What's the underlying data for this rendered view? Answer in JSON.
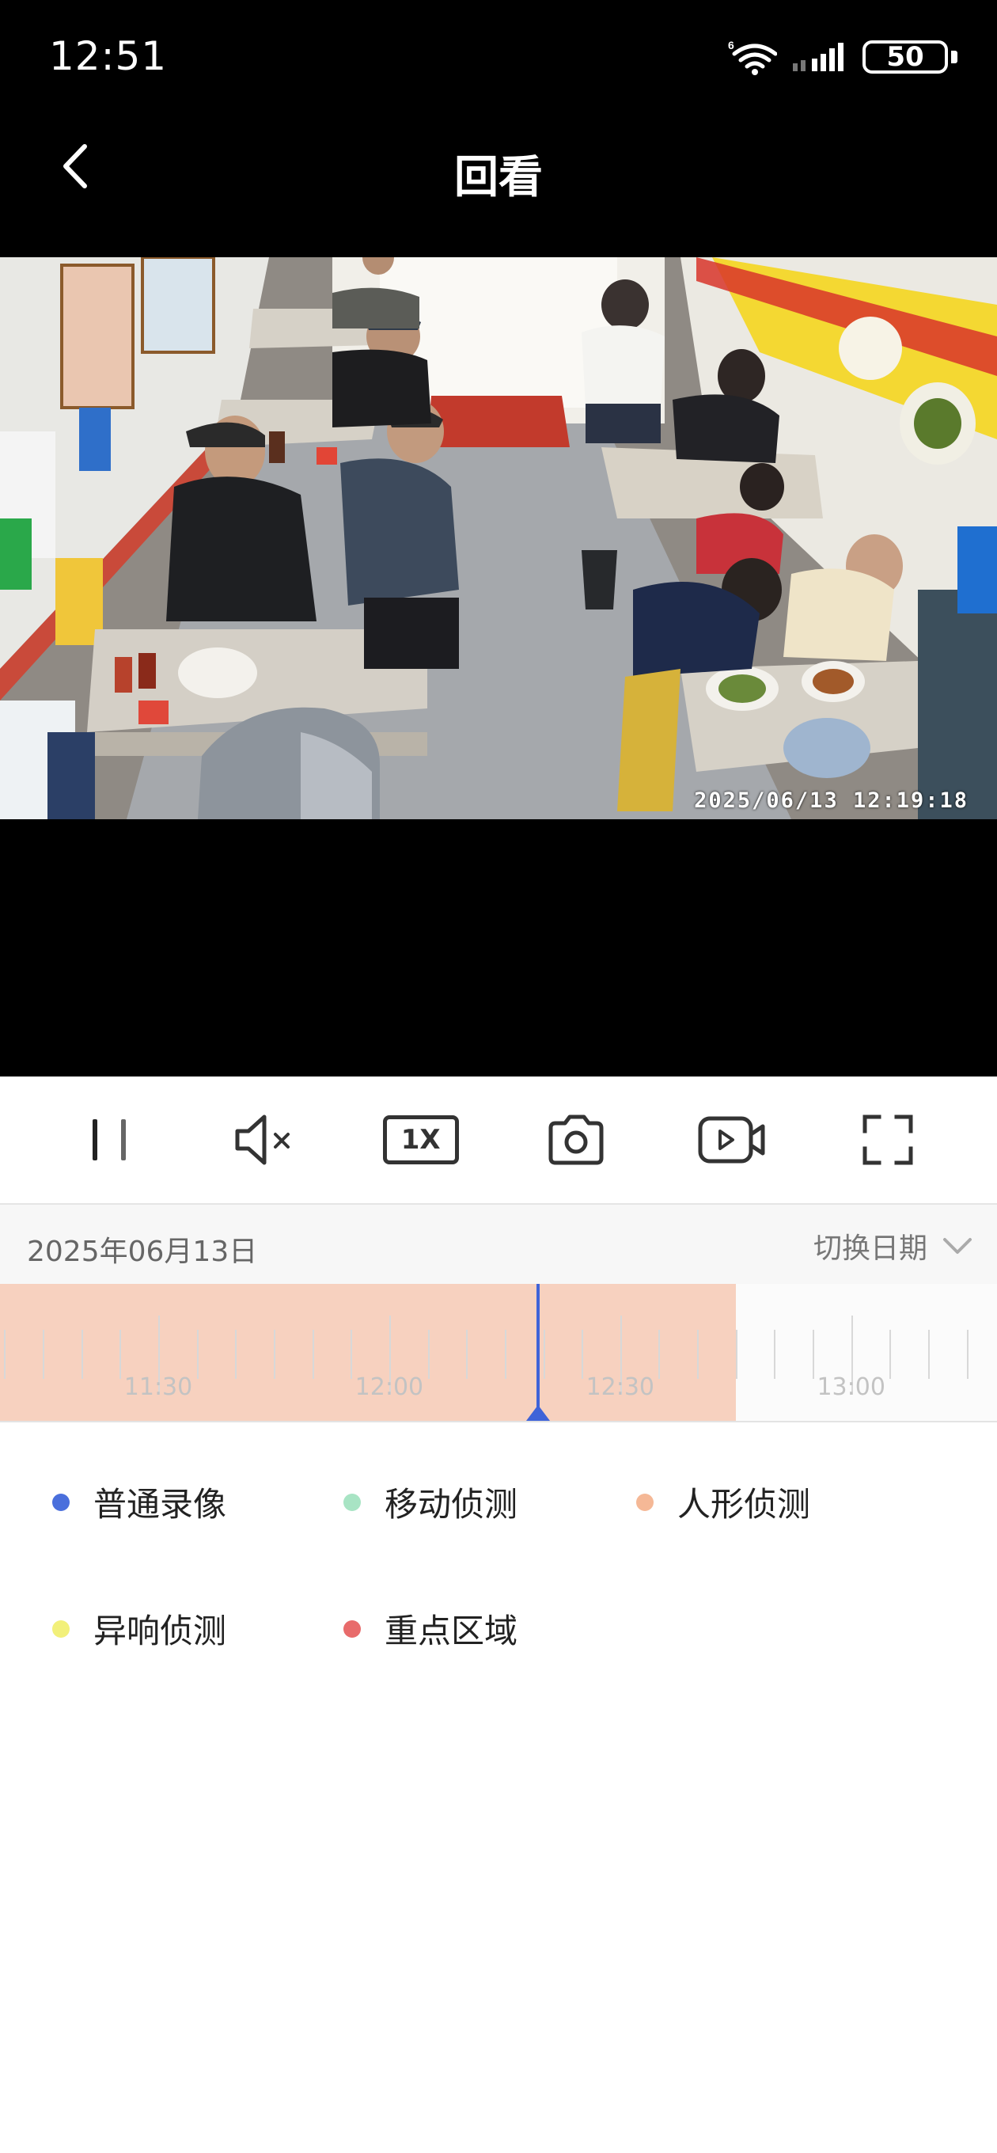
{
  "status": {
    "time": "12:51",
    "battery": "50"
  },
  "header": {
    "title": "回看"
  },
  "video": {
    "timestamp": "2025/06/13  12:19:18"
  },
  "controls": {
    "speed": "1X",
    "icons": [
      "pause-icon",
      "mute-icon",
      "speed-icon",
      "snapshot-icon",
      "record-icon",
      "fullscreen-icon"
    ]
  },
  "date_row": {
    "date": "2025年06月13日",
    "switch_label": "切换日期"
  },
  "timeline": {
    "labels": [
      "11:30",
      "12:00",
      "12:30",
      "13:00"
    ],
    "current_time": "12:19:18",
    "recorded_until": "12:45"
  },
  "legend": [
    {
      "label": "普通录像",
      "color": "#4a6fdc"
    },
    {
      "label": "移动侦测",
      "color": "#a8e4c4"
    },
    {
      "label": "人形侦测",
      "color": "#f5b896"
    },
    {
      "label": "异响侦测",
      "color": "#f2f07a"
    },
    {
      "label": "重点区域",
      "color": "#e86b6b"
    }
  ],
  "colors": {
    "accent": "#3f63d8",
    "timeline_fill": "#f7d1bf"
  }
}
